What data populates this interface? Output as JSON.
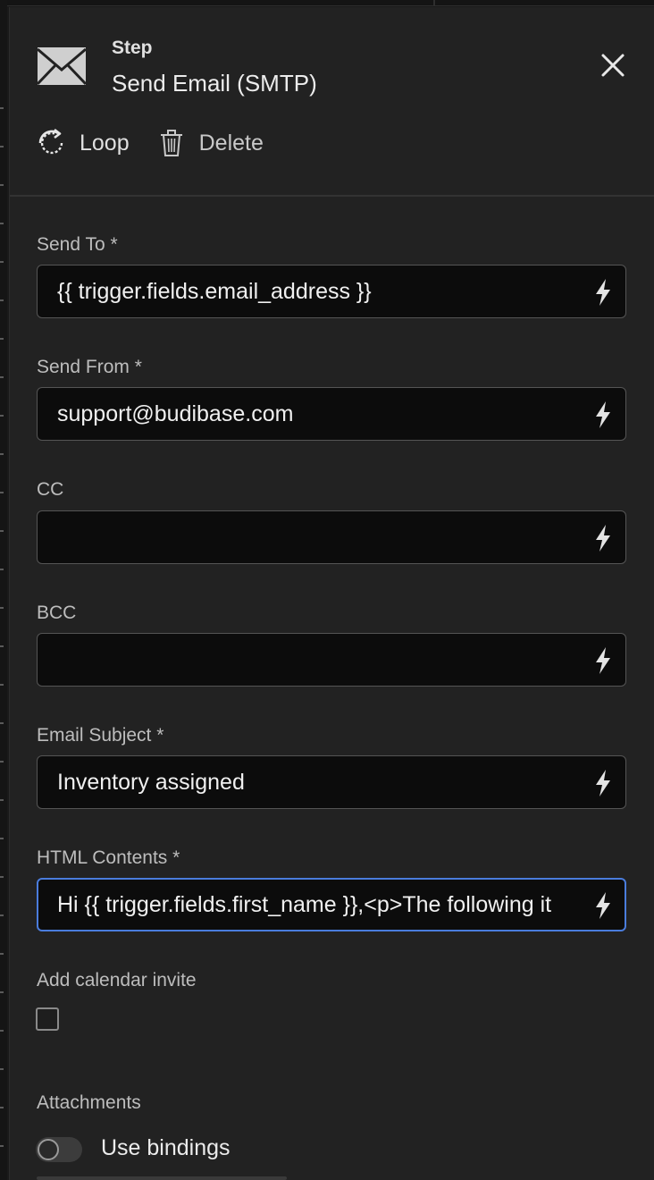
{
  "header": {
    "step_label": "Step",
    "step_title": "Send Email (SMTP)",
    "icons": {
      "step": "mail-icon",
      "close": "close-icon"
    }
  },
  "actions": {
    "loop_label": "Loop",
    "delete_label": "Delete",
    "icons": {
      "loop": "loop-icon",
      "delete": "trash-icon"
    }
  },
  "fields": {
    "send_to": {
      "label": "Send To *",
      "value": "{{ trigger.fields.email_address }}"
    },
    "send_from": {
      "label": "Send From *",
      "value": "support@budibase.com"
    },
    "cc": {
      "label": "CC",
      "value": ""
    },
    "bcc": {
      "label": "BCC",
      "value": ""
    },
    "subject": {
      "label": "Email Subject *",
      "value": "Inventory assigned"
    },
    "html_contents": {
      "label": "HTML Contents *",
      "value": "Hi {{ trigger.fields.first_name }},<p>The following it"
    }
  },
  "calendar": {
    "label": "Add calendar invite",
    "checked": false
  },
  "attachments": {
    "label": "Attachments",
    "toggle_label": "Use bindings",
    "toggle_on": false
  },
  "colors": {
    "panel_bg": "#222222",
    "input_bg": "#0c0c0c",
    "focus_border": "#4a7cdc",
    "text": "#ececec",
    "label": "#bdbdbd"
  }
}
